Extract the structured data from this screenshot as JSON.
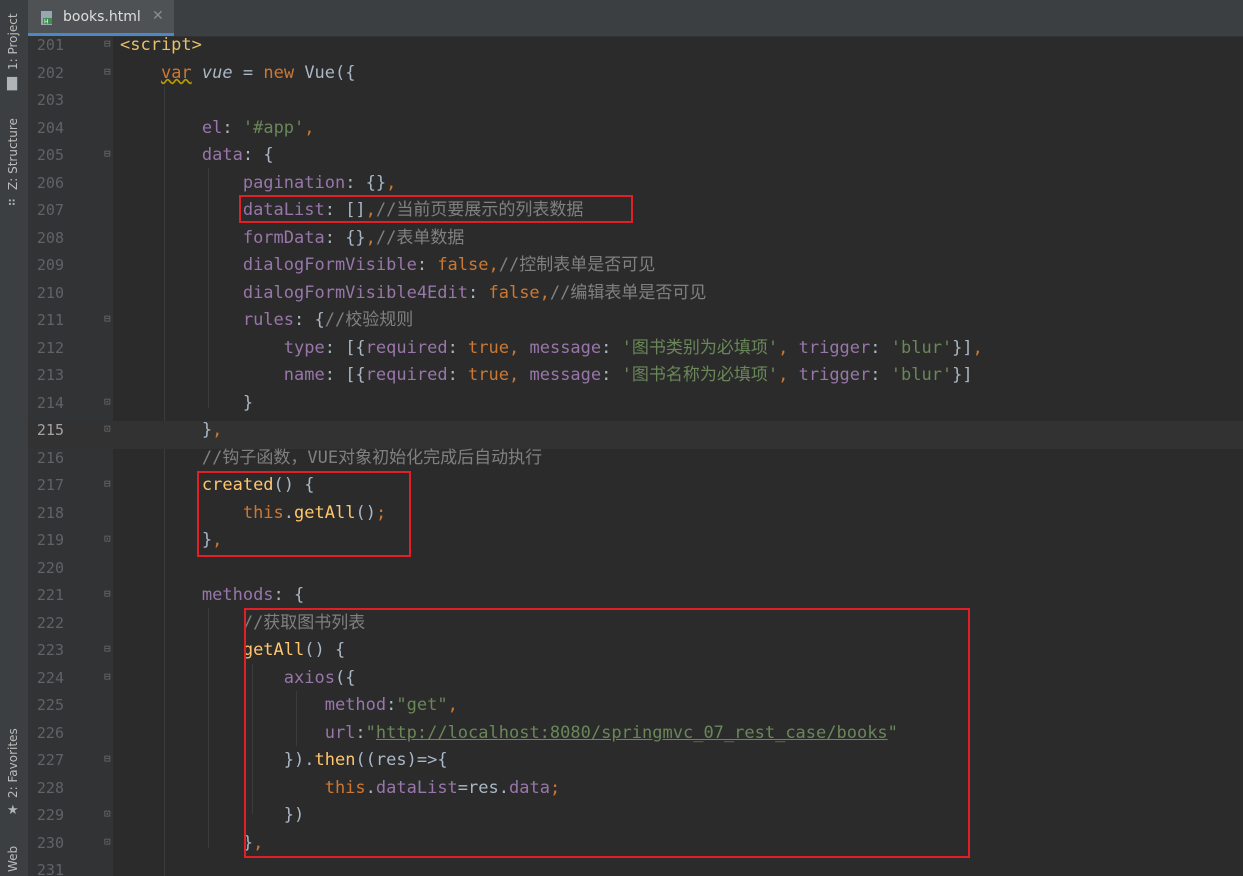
{
  "sidebar": {
    "project_label": "1: Project",
    "structure_label": "Z: Structure",
    "favorites_label": "2: Favorites",
    "web_label": "Web"
  },
  "tab": {
    "title": "books.html"
  },
  "editor": {
    "current_line": 215,
    "lines": [
      {
        "num": "201",
        "parts": [
          [
            "tag",
            "<script>"
          ]
        ]
      },
      {
        "num": "202",
        "parts": [
          [
            "pad",
            "    "
          ],
          [
            "kw",
            "var"
          ],
          [
            "plain",
            " "
          ],
          [
            "ital",
            "vue"
          ],
          [
            "plain",
            " = "
          ],
          [
            "kw",
            "new"
          ],
          [
            "plain",
            " Vue({"
          ]
        ]
      },
      {
        "num": "203",
        "parts": []
      },
      {
        "num": "204",
        "parts": [
          [
            "pad",
            "        "
          ],
          [
            "prop",
            "el"
          ],
          [
            "plain",
            ": "
          ],
          [
            "str",
            "'#app'"
          ],
          [
            "kw",
            ","
          ]
        ]
      },
      {
        "num": "205",
        "parts": [
          [
            "pad",
            "        "
          ],
          [
            "prop",
            "data"
          ],
          [
            "plain",
            ": {"
          ]
        ]
      },
      {
        "num": "206",
        "parts": [
          [
            "pad",
            "            "
          ],
          [
            "prop",
            "pagination"
          ],
          [
            "plain",
            ": {}"
          ],
          [
            "kw",
            ","
          ]
        ]
      },
      {
        "num": "207",
        "parts": [
          [
            "pad",
            "            "
          ],
          [
            "prop",
            "dataList"
          ],
          [
            "plain",
            ": []"
          ],
          [
            "kw",
            ","
          ],
          [
            "cmt",
            "//当前页要展示的列表数据"
          ]
        ]
      },
      {
        "num": "208",
        "parts": [
          [
            "pad",
            "            "
          ],
          [
            "prop",
            "formData"
          ],
          [
            "plain",
            ": {}"
          ],
          [
            "kw",
            ","
          ],
          [
            "cmt",
            "//表单数据"
          ]
        ]
      },
      {
        "num": "209",
        "parts": [
          [
            "pad",
            "            "
          ],
          [
            "prop",
            "dialogFormVisible"
          ],
          [
            "plain",
            ": "
          ],
          [
            "kw",
            "false,"
          ],
          [
            "cmt",
            "//控制表单是否可见"
          ]
        ]
      },
      {
        "num": "210",
        "parts": [
          [
            "pad",
            "            "
          ],
          [
            "prop",
            "dialogFormVisible4Edit"
          ],
          [
            "plain",
            ": "
          ],
          [
            "kw",
            "false,"
          ],
          [
            "cmt",
            "//编辑表单是否可见"
          ]
        ]
      },
      {
        "num": "211",
        "parts": [
          [
            "pad",
            "            "
          ],
          [
            "prop",
            "rules"
          ],
          [
            "plain",
            ": {"
          ],
          [
            "cmt",
            "//校验规则"
          ]
        ]
      },
      {
        "num": "212",
        "parts": [
          [
            "pad",
            "                "
          ],
          [
            "prop",
            "type"
          ],
          [
            "plain",
            ": [{"
          ],
          [
            "prop",
            "required"
          ],
          [
            "plain",
            ": "
          ],
          [
            "kw",
            "true,"
          ],
          [
            "plain",
            " "
          ],
          [
            "prop",
            "message"
          ],
          [
            "plain",
            ": "
          ],
          [
            "str",
            "'图书类别为必填项'"
          ],
          [
            "kw",
            ","
          ],
          [
            "plain",
            " "
          ],
          [
            "prop",
            "trigger"
          ],
          [
            "plain",
            ": "
          ],
          [
            "str",
            "'blur'"
          ],
          [
            "plain",
            "}]"
          ],
          [
            "kw",
            ","
          ]
        ]
      },
      {
        "num": "213",
        "parts": [
          [
            "pad",
            "                "
          ],
          [
            "prop",
            "name"
          ],
          [
            "plain",
            ": [{"
          ],
          [
            "prop",
            "required"
          ],
          [
            "plain",
            ": "
          ],
          [
            "kw",
            "true,"
          ],
          [
            "plain",
            " "
          ],
          [
            "prop",
            "message"
          ],
          [
            "plain",
            ": "
          ],
          [
            "str",
            "'图书名称为必填项'"
          ],
          [
            "kw",
            ","
          ],
          [
            "plain",
            " "
          ],
          [
            "prop",
            "trigger"
          ],
          [
            "plain",
            ": "
          ],
          [
            "str",
            "'blur'"
          ],
          [
            "plain",
            "}]"
          ]
        ]
      },
      {
        "num": "214",
        "parts": [
          [
            "pad",
            "            "
          ],
          [
            "plain",
            "}"
          ]
        ]
      },
      {
        "num": "215",
        "parts": [
          [
            "pad",
            "        "
          ],
          [
            "plain",
            "}"
          ],
          [
            "kw",
            ","
          ]
        ]
      },
      {
        "num": "216",
        "parts": [
          [
            "pad",
            "        "
          ],
          [
            "cmt",
            "//钩子函数，VUE对象初始化完成后自动执行"
          ]
        ]
      },
      {
        "num": "217",
        "parts": [
          [
            "pad",
            "        "
          ],
          [
            "fn",
            "created"
          ],
          [
            "plain",
            "() {"
          ]
        ]
      },
      {
        "num": "218",
        "parts": [
          [
            "pad",
            "            "
          ],
          [
            "kw",
            "this"
          ],
          [
            "plain",
            "."
          ],
          [
            "fn",
            "getAll"
          ],
          [
            "plain",
            "()"
          ],
          [
            "kw",
            ";"
          ]
        ]
      },
      {
        "num": "219",
        "parts": [
          [
            "pad",
            "        "
          ],
          [
            "plain",
            "}"
          ],
          [
            "kw",
            ","
          ]
        ]
      },
      {
        "num": "220",
        "parts": []
      },
      {
        "num": "221",
        "parts": [
          [
            "pad",
            "        "
          ],
          [
            "prop",
            "methods"
          ],
          [
            "plain",
            ": {"
          ]
        ]
      },
      {
        "num": "222",
        "parts": [
          [
            "pad",
            "            "
          ],
          [
            "cmt",
            "//获取图书列表"
          ]
        ]
      },
      {
        "num": "223",
        "parts": [
          [
            "pad",
            "            "
          ],
          [
            "fn",
            "getAll"
          ],
          [
            "plain",
            "() {"
          ]
        ]
      },
      {
        "num": "224",
        "parts": [
          [
            "pad",
            "                "
          ],
          [
            "prop",
            "axios"
          ],
          [
            "plain",
            "({"
          ]
        ]
      },
      {
        "num": "225",
        "parts": [
          [
            "pad",
            "                    "
          ],
          [
            "prop",
            "method"
          ],
          [
            "plain",
            ":"
          ],
          [
            "str",
            "\"get\""
          ],
          [
            "kw",
            ","
          ]
        ]
      },
      {
        "num": "226",
        "parts": [
          [
            "pad",
            "                    "
          ],
          [
            "prop",
            "url"
          ],
          [
            "plain",
            ":"
          ],
          [
            "str",
            "\""
          ],
          [
            "url",
            "http://localhost:8080/springmvc_07_rest_case/books"
          ],
          [
            "str",
            "\""
          ]
        ]
      },
      {
        "num": "227",
        "parts": [
          [
            "pad",
            "                "
          ],
          [
            "plain",
            "})."
          ],
          [
            "fn",
            "then"
          ],
          [
            "plain",
            "((res)=>{"
          ]
        ]
      },
      {
        "num": "228",
        "parts": [
          [
            "pad",
            "                    "
          ],
          [
            "kw",
            "this"
          ],
          [
            "plain",
            "."
          ],
          [
            "prop",
            "dataList"
          ],
          [
            "plain",
            "=res."
          ],
          [
            "prop",
            "data"
          ],
          [
            "kw",
            ";"
          ]
        ]
      },
      {
        "num": "229",
        "parts": [
          [
            "pad",
            "                "
          ],
          [
            "plain",
            "})"
          ]
        ]
      },
      {
        "num": "230",
        "parts": [
          [
            "pad",
            "            "
          ],
          [
            "plain",
            "}"
          ],
          [
            "kw",
            ","
          ]
        ]
      },
      {
        "num": "231",
        "parts": []
      }
    ]
  }
}
